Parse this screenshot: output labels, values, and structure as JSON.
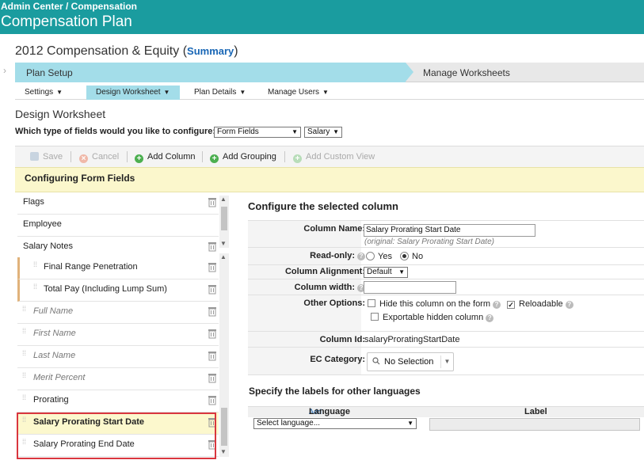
{
  "header": {
    "breadcrumb": "Admin Center / Compensation",
    "title": "Compensation Plan"
  },
  "plan": {
    "title": "2012 Compensation & Equity",
    "summary_link": "Summary"
  },
  "steps": [
    {
      "label": "Plan Setup",
      "active": true
    },
    {
      "label": "Manage Worksheets",
      "active": false
    }
  ],
  "subnav": [
    {
      "label": "Settings"
    },
    {
      "label": "Design Worksheet",
      "active": true
    },
    {
      "label": "Plan Details"
    },
    {
      "label": "Manage Users"
    }
  ],
  "section_title": "Design Worksheet",
  "question": {
    "label": "Which type of fields would you like to configure:",
    "field_type": "Form Fields",
    "category": "Salary"
  },
  "toolbar": {
    "save": "Save",
    "cancel": "Cancel",
    "add_column": "Add Column",
    "add_grouping": "Add Grouping",
    "add_custom_view": "Add Custom View"
  },
  "banner": "Configuring Form Fields",
  "top_list": [
    {
      "label": "Flags"
    },
    {
      "label": "Employee"
    },
    {
      "label": "Salary Notes"
    }
  ],
  "column_list": [
    {
      "label": "Final Range Penetration",
      "italic": false,
      "grouped": true
    },
    {
      "label": "Total Pay (Including Lump Sum)",
      "italic": false,
      "grouped": true
    },
    {
      "label": "Full Name",
      "italic": true,
      "grouped": false
    },
    {
      "label": "First Name",
      "italic": true,
      "grouped": false
    },
    {
      "label": "Last Name",
      "italic": true,
      "grouped": false
    },
    {
      "label": "Merit Percent",
      "italic": true,
      "grouped": false
    },
    {
      "label": "Prorating",
      "italic": false,
      "grouped": false
    },
    {
      "label": "Salary Prorating Start Date",
      "italic": false,
      "grouped": false,
      "selected": true
    },
    {
      "label": "Salary Prorating End Date",
      "italic": false,
      "grouped": false
    }
  ],
  "form": {
    "title": "Configure the selected column",
    "column_name_label": "Column Name:",
    "column_name_value": "Salary Prorating Start Date",
    "column_name_original": "(original: Salary Prorating Start Date)",
    "readonly_label": "Read-only:",
    "readonly_yes": "Yes",
    "readonly_no": "No",
    "readonly_value": "No",
    "alignment_label": "Column Alignment:",
    "alignment_value": "Default",
    "width_label": "Column width:",
    "width_value": "",
    "other_label": "Other Options:",
    "hide_label": "Hide this column on the form",
    "hide_checked": false,
    "reloadable_label": "Reloadable",
    "reloadable_checked": true,
    "exportable_label": "Exportable hidden column",
    "exportable_checked": false,
    "column_id_label": "Column Id:",
    "column_id_value": "salaryProratingStartDate",
    "ec_label": "EC Category:",
    "ec_value": "No Selection"
  },
  "languages": {
    "title": "Specify the labels for other languages",
    "language_header": "Language",
    "add_link": "Add",
    "label_header": "Label",
    "select_placeholder": "Select language..."
  }
}
